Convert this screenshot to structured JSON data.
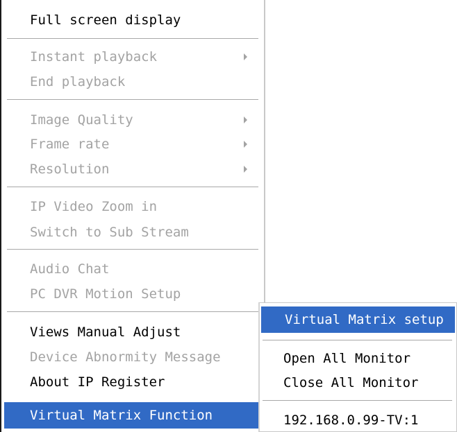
{
  "main_menu": {
    "items": [
      {
        "label": "Full screen display",
        "enabled": true
      },
      {
        "label": "Instant playback",
        "enabled": false,
        "submenu": true
      },
      {
        "label": "End playback",
        "enabled": false
      },
      {
        "label": "Image Quality",
        "enabled": false,
        "submenu": true
      },
      {
        "label": "Frame rate",
        "enabled": false,
        "submenu": true
      },
      {
        "label": "Resolution",
        "enabled": false,
        "submenu": true
      },
      {
        "label": "IP Video Zoom in",
        "enabled": false
      },
      {
        "label": "Switch to Sub Stream",
        "enabled": false
      },
      {
        "label": "Audio Chat",
        "enabled": false
      },
      {
        "label": "PC DVR Motion Setup",
        "enabled": false
      },
      {
        "label": "Views Manual Adjust",
        "enabled": true
      },
      {
        "label": "Device Abnormity Message",
        "enabled": false
      },
      {
        "label": "About IP Register",
        "enabled": true
      },
      {
        "label": "Virtual Matrix Function",
        "enabled": true,
        "highlighted": true,
        "submenu": true
      }
    ]
  },
  "sub_menu": {
    "items": [
      {
        "label": "Virtual Matrix setup",
        "enabled": true,
        "highlighted": true
      },
      {
        "label": "Open All Monitor",
        "enabled": true
      },
      {
        "label": "Close All Monitor",
        "enabled": true
      },
      {
        "label": "192.168.0.99-TV:1",
        "enabled": true
      }
    ]
  },
  "colors": {
    "highlight": "#316ac5",
    "disabled_text": "#a3a3a3",
    "text": "#000000"
  }
}
